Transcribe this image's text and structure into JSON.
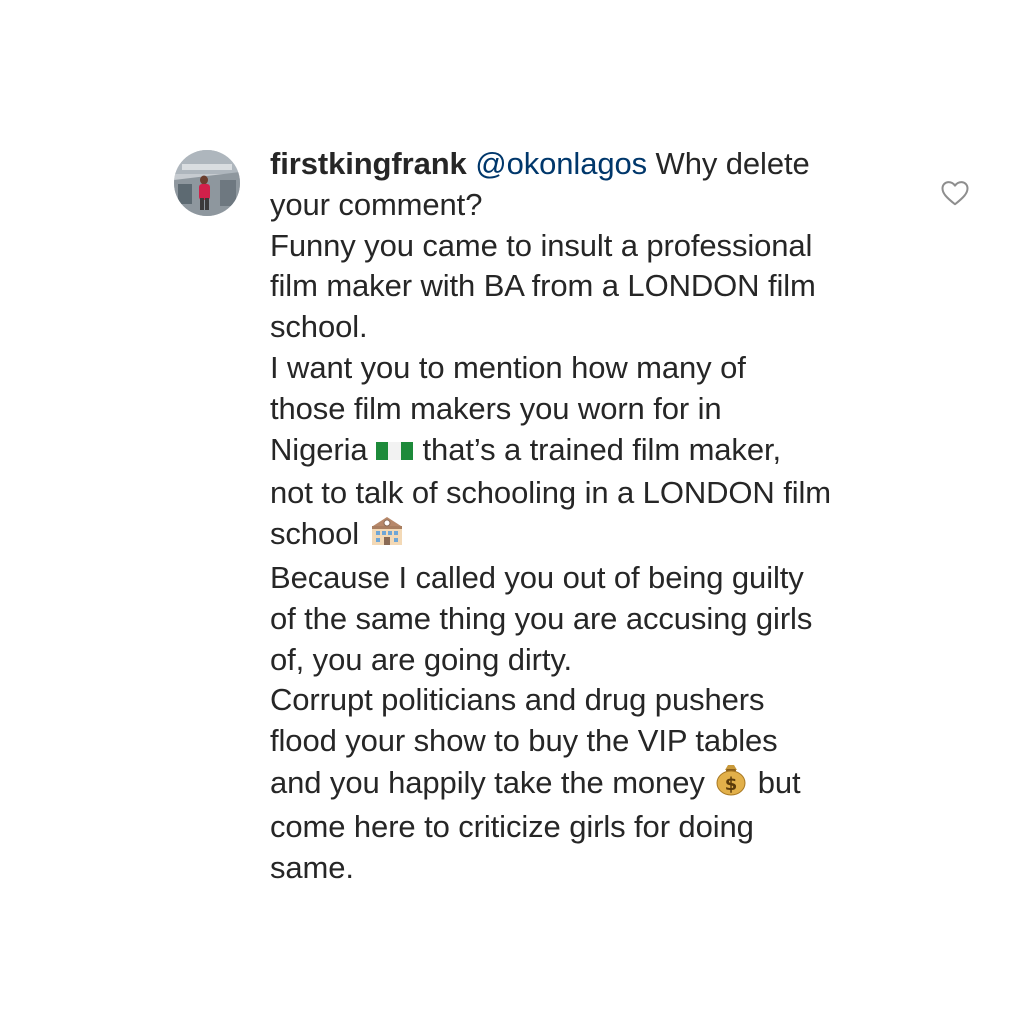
{
  "comment": {
    "username": "firstkingfrank",
    "mention": "@okonlagos",
    "lines": [
      " Why delete",
      "your comment?",
      "Funny you came to insult a professional",
      "film maker with BA from a LONDON film",
      "school.",
      "I want you to mention how many of",
      "those film makers you worn for in",
      "Nigeria",
      " that’s a trained film maker,",
      "not to talk of schooling in a LONDON film",
      "school",
      "Because I called you out of being guilty",
      "of the same thing you are accusing girls",
      "of, you are going dirty.",
      "Corrupt politicians and drug pushers",
      "flood your show to buy the VIP tables",
      "and you happily take the money",
      " but",
      "come here to criticize girls for doing",
      "same."
    ]
  },
  "icons": {
    "nigeria_flag": "nigeria-flag-emoji",
    "school": "school-building-emoji",
    "money_bag": "money-bag-emoji",
    "like": "heart-outline-icon"
  },
  "colors": {
    "text": "#262626",
    "mention": "#00376b",
    "heart_outline": "#8e8e8e",
    "flag_green": "#1d8a3a"
  }
}
